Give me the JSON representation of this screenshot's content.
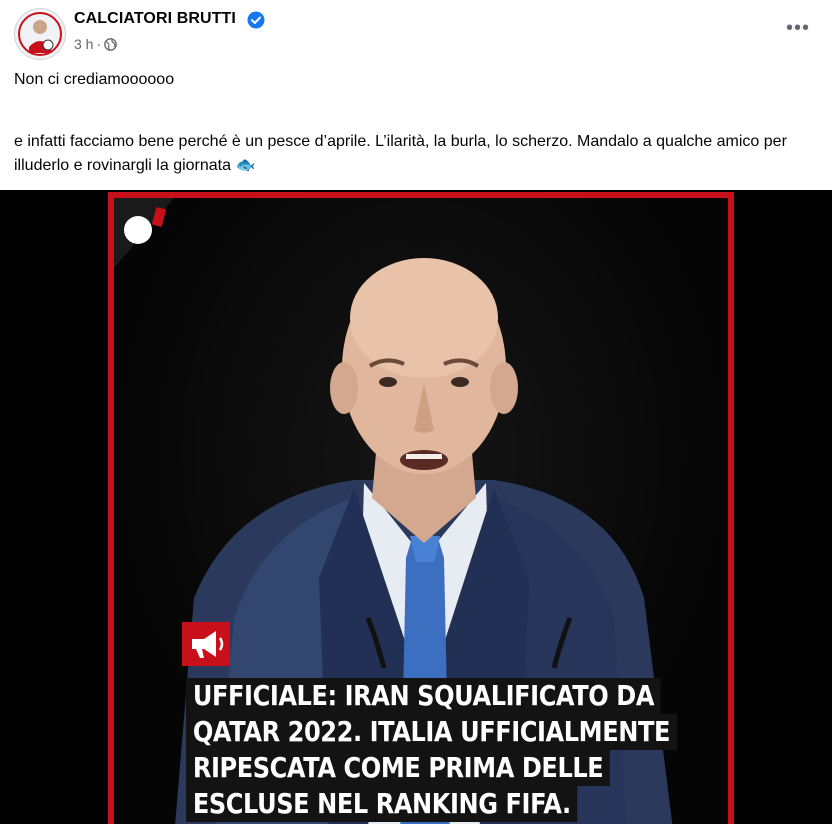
{
  "post": {
    "page_name": "CALCIATORI BRUTTI",
    "time": "3 h",
    "separator": "·",
    "more_label": "•••",
    "text_line1": "Non ci crediamoooooo",
    "text_line2": "e infatti facciamo bene perché è un pesce d’aprile. L’ilarità, la burla, lo scherzo. Mandalo a qualche amico per illuderlo e rovinargli la giornata 🐟"
  },
  "image": {
    "headline_lines": [
      "UFFICIALE: IRAN SQUALIFICATO DA",
      "QATAR 2022. ITALIA UFFICIALMENTE",
      "RIPESCATA COME PRIMA DELLE",
      "ESCLUSE NEL RANKING FIFA."
    ]
  },
  "colors": {
    "brand_red": "#c8101b",
    "verified_blue": "#1877f2",
    "meta_gray": "#65676b"
  },
  "icons": {
    "verified": "verified-badge-icon",
    "audience": "globe-icon",
    "more": "more-options-icon",
    "megaphone": "megaphone-icon"
  }
}
